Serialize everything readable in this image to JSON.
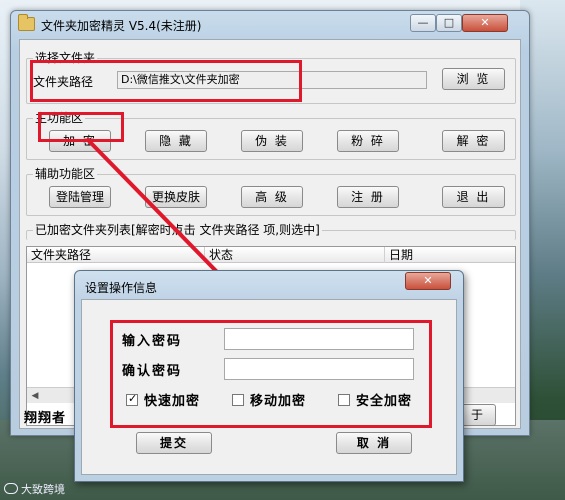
{
  "window": {
    "title": "文件夹加密精灵 V5.4(未注册)"
  },
  "select_folder": {
    "group_label": "选择文件夹",
    "path_label": "文件夹路径",
    "path_value": "D:\\微信推文\\文件夹加密",
    "browse_label": "浏 览"
  },
  "main_functions": {
    "group_label": "主功能区",
    "buttons": [
      "加 密",
      "隐 藏",
      "伪 装",
      "粉 碎",
      "解 密"
    ]
  },
  "aux_functions": {
    "group_label": "辅助功能区",
    "buttons": [
      "登陆管理",
      "更换皮肤",
      "高 级",
      "注 册",
      "退 出"
    ]
  },
  "encrypted_list": {
    "group_label": "已加密文件夹列表[解密时点击 文件夹路径 项,则选中]",
    "columns": [
      "文件夹路径",
      "状态",
      "日期"
    ]
  },
  "status_text": "翔翔者",
  "about_label": "于",
  "dialog": {
    "title": "设置操作信息",
    "password_label": "输入密码",
    "confirm_label": "确认密码",
    "password_value": "",
    "confirm_value": "",
    "options": [
      {
        "label": "快速加密",
        "checked": true
      },
      {
        "label": "移动加密",
        "checked": false
      },
      {
        "label": "安全加密",
        "checked": false
      }
    ],
    "submit_label": "提交",
    "cancel_label": "取 消"
  },
  "watermark": "大致跨境",
  "colors": {
    "highlight": "#e0182c",
    "dialog_bg": "#f0f0f0",
    "title_bar": "#c9dcec"
  }
}
